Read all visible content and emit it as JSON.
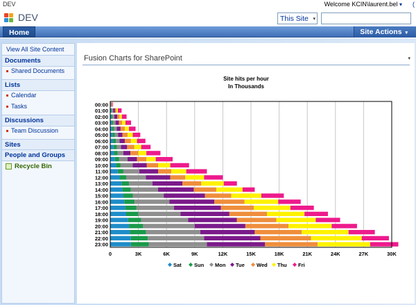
{
  "topbar": {
    "site_label": "DEV",
    "welcome": "Welcome KCIN\\laurent.bel",
    "welcome_arrow": "▾",
    "help_icon": "(",
    "help_icon_name": "help-icon"
  },
  "header": {
    "site_title": "DEV",
    "scope_select": "This Site",
    "scope_arrow": "▾",
    "search_value": "",
    "logo_icon": "sharepoint-logo-icon"
  },
  "navbar": {
    "home_label": "Home",
    "site_actions_label": "Site Actions",
    "site_actions_arrow": "▾"
  },
  "quicklaunch": {
    "view_all": "View All Site Content",
    "sections": [
      {
        "header": "Documents",
        "items": [
          "Shared Documents"
        ]
      },
      {
        "header": "Lists",
        "items": [
          "Calendar",
          "Tasks"
        ]
      },
      {
        "header": "Discussions",
        "items": [
          "Team Discussion"
        ]
      },
      {
        "header": "Sites",
        "items": []
      },
      {
        "header": "People and Groups",
        "items": []
      }
    ],
    "recycle_bin": "Recycle Bin",
    "recycle_icon": "recycle-bin-icon"
  },
  "webpart": {
    "title": "Fusion Charts for SharePoint",
    "menu_arrow": "▾"
  },
  "colors": {
    "Sat": "#1f8dc9",
    "Sun": "#1a9a4a",
    "Mon": "#8f8f8f",
    "Tue": "#7b1a8a",
    "Wed": "#ef8e3c",
    "Thu": "#fff200",
    "Fri": "#ee1a8c"
  },
  "chart_data": {
    "type": "bar",
    "orientation": "horizontal",
    "stacked": true,
    "title": "Site hits per hour",
    "subtitle": "In Thousands",
    "xlim": [
      0,
      30000
    ],
    "x_ticks": [
      "0",
      "3K",
      "6K",
      "9K",
      "12K",
      "15K",
      "18K",
      "21K",
      "24K",
      "27K",
      "30K"
    ],
    "x_tick_values": [
      0,
      3000,
      6000,
      9000,
      12000,
      15000,
      18000,
      21000,
      24000,
      27000,
      30000
    ],
    "grid": true,
    "legend_position": "bottom",
    "categories": [
      "00:00",
      "01:00",
      "02:00",
      "03:00",
      "04:00",
      "05:00",
      "06:00",
      "07:00",
      "08:00",
      "09:00",
      "10:00",
      "11:00",
      "12:00",
      "13:00",
      "14:00",
      "15:00",
      "16:00",
      "17:00",
      "18:00",
      "19:00",
      "20:00",
      "21:00",
      "22:00",
      "23:00"
    ],
    "series": [
      {
        "name": "Sat",
        "values": [
          30,
          80,
          120,
          160,
          200,
          250,
          300,
          350,
          400,
          500,
          600,
          800,
          1000,
          1200,
          1300,
          1400,
          1500,
          1600,
          1700,
          1900,
          2000,
          2100,
          2200,
          2200
        ]
      },
      {
        "name": "Sun",
        "values": [
          30,
          80,
          120,
          160,
          200,
          250,
          300,
          350,
          400,
          450,
          500,
          600,
          700,
          800,
          900,
          1000,
          1100,
          1200,
          1300,
          1400,
          1500,
          1700,
          1800,
          1900
        ]
      },
      {
        "name": "Mon",
        "values": [
          40,
          150,
          200,
          250,
          300,
          350,
          400,
          450,
          600,
          900,
          1300,
          1700,
          2100,
          2500,
          2900,
          3300,
          3700,
          4000,
          4500,
          5000,
          5500,
          5800,
          6000,
          6200
        ]
      },
      {
        "name": "Tue",
        "values": [
          50,
          200,
          300,
          350,
          400,
          450,
          550,
          650,
          750,
          1000,
          1500,
          2000,
          2600,
          3200,
          3800,
          4400,
          4800,
          5000,
          5200,
          5200,
          5400,
          5800,
          6000,
          6200
        ]
      },
      {
        "name": "Wed",
        "values": [
          40,
          150,
          250,
          350,
          450,
          550,
          650,
          750,
          850,
          1000,
          1200,
          1400,
          1600,
          2000,
          2400,
          2800,
          3200,
          3500,
          4000,
          4200,
          4600,
          5000,
          5400,
          5600
        ]
      },
      {
        "name": "Thu",
        "values": [
          40,
          150,
          250,
          350,
          450,
          550,
          650,
          750,
          850,
          1000,
          1300,
          1600,
          2000,
          2400,
          2800,
          3200,
          3600,
          3900,
          4000,
          4200,
          4600,
          5000,
          5400,
          5600
        ]
      },
      {
        "name": "Fri",
        "values": [
          60,
          400,
          500,
          600,
          700,
          800,
          900,
          1000,
          1500,
          1800,
          2000,
          2200,
          2000,
          1400,
          1300,
          2400,
          2400,
          2500,
          2500,
          2600,
          2700,
          2800,
          2900,
          3000
        ]
      }
    ]
  }
}
